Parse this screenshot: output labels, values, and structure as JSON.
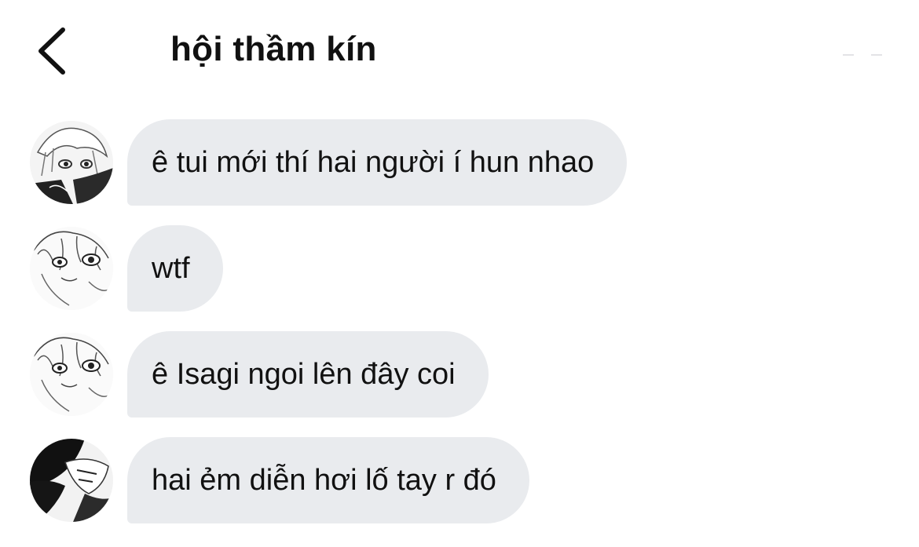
{
  "header": {
    "title": "hội thầm kín",
    "back_icon": "chevron-left-icon"
  },
  "messages": [
    {
      "avatar": "avatar-white-hair",
      "text": "ê tui mới thí hai người í hun nhao"
    },
    {
      "avatar": "avatar-sketch-face",
      "text": "wtf"
    },
    {
      "avatar": "avatar-sketch-face",
      "text": "ê Isagi ngoi lên đây coi"
    },
    {
      "avatar": "avatar-dark-hair",
      "text": "hai ẻm diễn hơi lố tay r đó"
    }
  ],
  "colors": {
    "bubble": "#e9ebee",
    "text": "#111111",
    "background": "#ffffff"
  }
}
